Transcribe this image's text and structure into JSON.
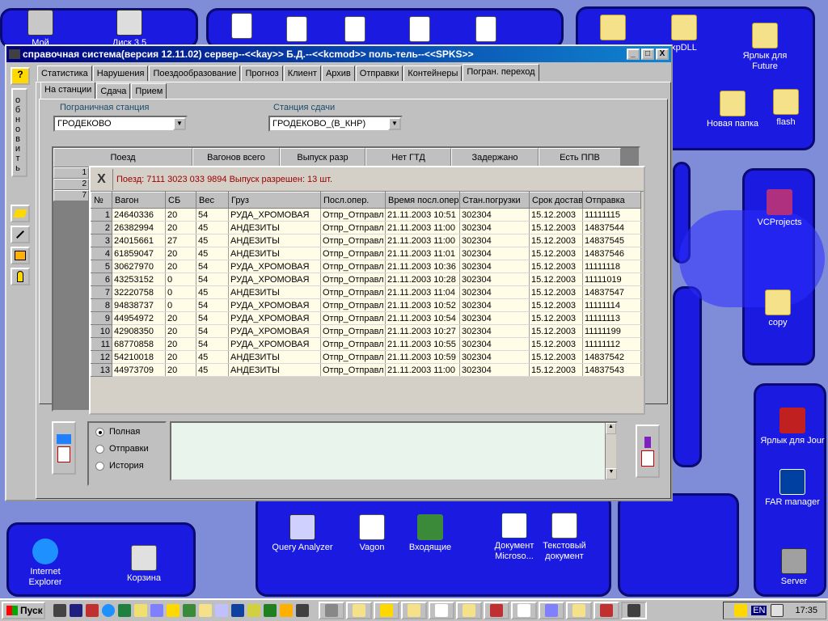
{
  "desktop": {
    "icons": {
      "my_computer": "Мой",
      "disk": "Диск 3.5",
      "xpdll": "xpDLL",
      "jarlyk_future": "Ярлык для Future",
      "new_folder": "Новая папка",
      "flash": "flash",
      "vcprojects": "VCProjects",
      "copy": "copy",
      "jarlyk_jour": "Ярлык для Jour",
      "far": "FAR manager",
      "server": "Server",
      "ie": "Internet Explorer",
      "recycle": "Корзина",
      "query": "Query Analyzer",
      "vagon": "Vagon",
      "incoming": "Входящие",
      "worddoc": "Документ Microso...",
      "textdoc": "Текстовый документ"
    }
  },
  "window": {
    "title": "справочная система(версия 12.11.02) сервер--<<kay>> Б.Д.--<<kcmod>> поль-тель--<<SPKS>>",
    "btn_min": "_",
    "btn_max": "□",
    "btn_close": "X"
  },
  "sidebar": {
    "help_label": "?",
    "refresh_label": "обновить"
  },
  "tabs": [
    "Статистика",
    "Нарушения",
    "Поездообразование",
    "Прогноз",
    "Клиент",
    "Архив",
    "Отправки",
    "Контейнеры",
    "Погран. переход"
  ],
  "subtabs": [
    "На станции",
    "Сдача",
    "Прием"
  ],
  "form": {
    "border_station_label": "Пограничная станция",
    "border_station_value": "ГРОДЕКОВО",
    "handover_label": "Станция сдачи",
    "handover_value": "ГРОДЕКОВО_(В_КНР)"
  },
  "summary": {
    "headers": [
      "Поезд",
      "Вагонов всего",
      "Выпуск разр",
      "Нет ГТД",
      "Задержано",
      "Есть ППВ"
    ],
    "rows": [
      "1",
      "2",
      "7"
    ]
  },
  "detail": {
    "close_label": "X",
    "caption": "Поезд:  7111 3023 033 9894   Выпуск разрешен: 13 шт.",
    "columns": [
      "№",
      "Вагон",
      "СБ",
      "Вес",
      "Груз",
      "Посл.опер.",
      "Время посл.опер",
      "Стан.погрузки",
      "Срок достав",
      "Отправка"
    ],
    "rows": [
      [
        "1",
        "24640336",
        "20",
        "54",
        "РУДА_ХРОМОВАЯ",
        "Отпр_Отправл",
        "21.11.2003  10:51",
        "302304",
        "15.12.2003",
        "11111115"
      ],
      [
        "2",
        "26382994",
        "20",
        "45",
        "АНДЕЗИТЫ",
        "Отпр_Отправл",
        "21.11.2003  11:00",
        "302304",
        "15.12.2003",
        "14837544"
      ],
      [
        "3",
        "24015661",
        "27",
        "45",
        "АНДЕЗИТЫ",
        "Отпр_Отправл",
        "21.11.2003  11:00",
        "302304",
        "15.12.2003",
        "14837545"
      ],
      [
        "4",
        "61859047",
        "20",
        "45",
        "АНДЕЗИТЫ",
        "Отпр_Отправл",
        "21.11.2003  11:01",
        "302304",
        "15.12.2003",
        "14837546"
      ],
      [
        "5",
        "30627970",
        "20",
        "54",
        "РУДА_ХРОМОВАЯ",
        "Отпр_Отправл",
        "21.11.2003  10:36",
        "302304",
        "15.12.2003",
        "11111118"
      ],
      [
        "6",
        "43253152",
        "0",
        "54",
        "РУДА_ХРОМОВАЯ",
        "Отпр_Отправл",
        "21.11.2003  10:28",
        "302304",
        "15.12.2003",
        "11111019"
      ],
      [
        "7",
        "32220758",
        "0",
        "45",
        "АНДЕЗИТЫ",
        "Отпр_Отправл",
        "21.11.2003  11:04",
        "302304",
        "15.12.2003",
        "14837547"
      ],
      [
        "8",
        "94838737",
        "0",
        "54",
        "РУДА_ХРОМОВАЯ",
        "Отпр_Отправл",
        "21.11.2003  10:52",
        "302304",
        "15.12.2003",
        "11111114"
      ],
      [
        "9",
        "44954972",
        "20",
        "54",
        "РУДА_ХРОМОВАЯ",
        "Отпр_Отправл",
        "21.11.2003  10:54",
        "302304",
        "15.12.2003",
        "11111113"
      ],
      [
        "10",
        "42908350",
        "20",
        "54",
        "РУДА_ХРОМОВАЯ",
        "Отпр_Отправл",
        "21.11.2003  10:27",
        "302304",
        "15.12.2003",
        "11111199"
      ],
      [
        "11",
        "68770858",
        "20",
        "54",
        "РУДА_ХРОМОВАЯ",
        "Отпр_Отправл",
        "21.11.2003  10:55",
        "302304",
        "15.12.2003",
        "11111112"
      ],
      [
        "12",
        "54210018",
        "20",
        "45",
        "АНДЕЗИТЫ",
        "Отпр_Отправл",
        "21.11.2003  10:59",
        "302304",
        "15.12.2003",
        "14837542"
      ],
      [
        "13",
        "44973709",
        "20",
        "45",
        "АНДЕЗИТЫ",
        "Отпр_Отправл",
        "21.11.2003  11:00",
        "302304",
        "15.12.2003",
        "14837543"
      ]
    ]
  },
  "options": {
    "full": "Полная",
    "shipments": "Отправки",
    "history": "История",
    "selected": "Полная"
  },
  "taskbar": {
    "start": "Пуск",
    "clock": "17:35",
    "lang": "EN"
  },
  "colors": {
    "desktop_bg": "#7f8cd8",
    "panel_blue": "#1a1ae0",
    "title_from": "#000080",
    "title_to": "#1084d0",
    "caption_red": "#a00000",
    "grid_row": "#fffde8"
  }
}
